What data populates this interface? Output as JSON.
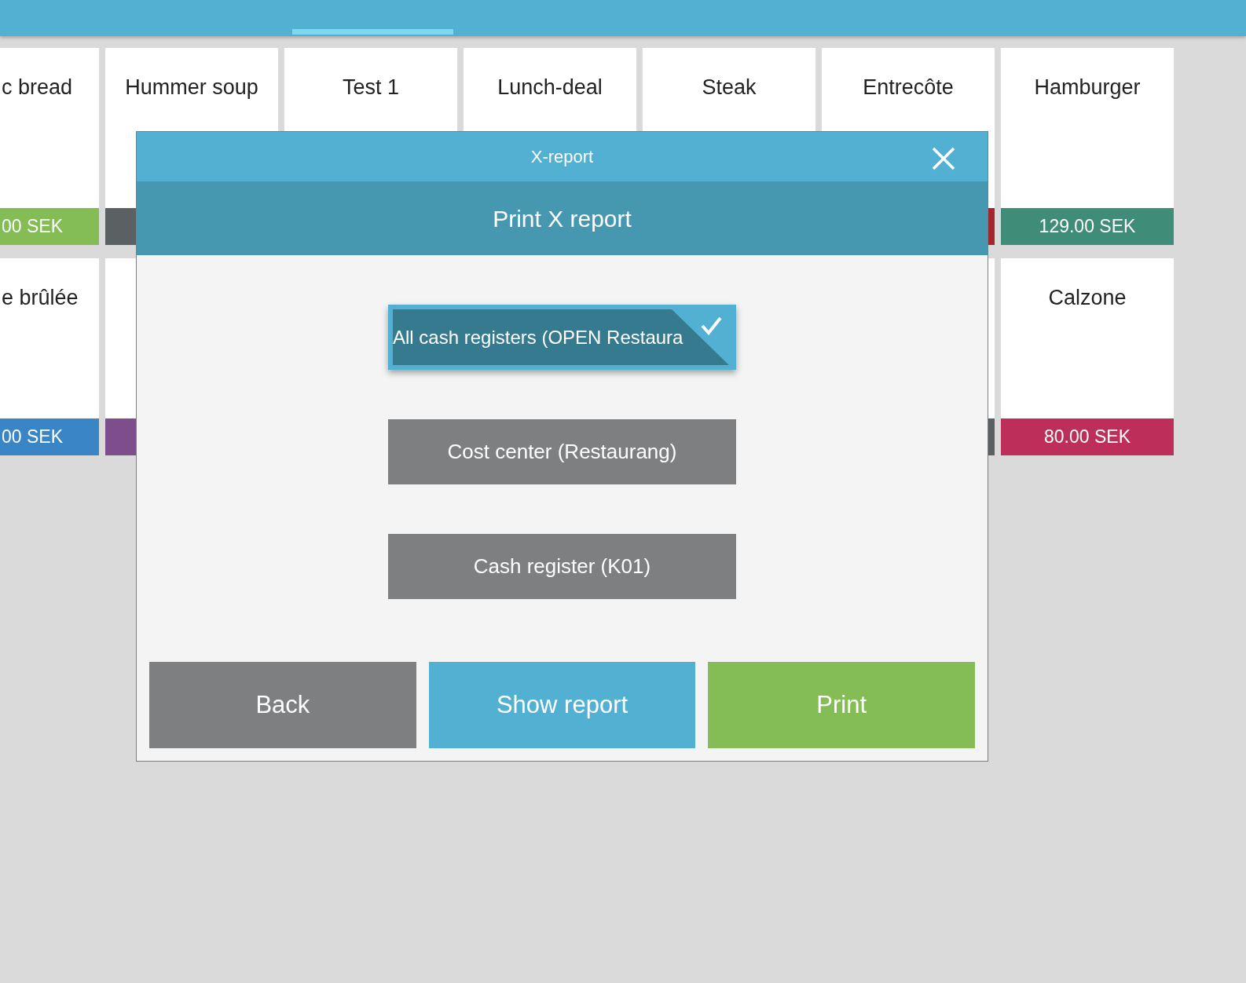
{
  "product_grid": {
    "rows": [
      [
        {
          "name": "c bread",
          "price": "00 SEK",
          "color": "#84bd55"
        },
        {
          "name": "Hummer soup",
          "color": "#5b6063"
        },
        {
          "name": "Test 1"
        },
        {
          "name": "Lunch-deal"
        },
        {
          "name": "Steak"
        },
        {
          "name": "Entrecôte",
          "color": "#a3272d"
        },
        {
          "name": "Hamburger",
          "price": "129.00 SEK",
          "color": "#3f8c78"
        }
      ],
      [
        {
          "name": "e brûlée",
          "price": "00 SEK",
          "color": "#3a85c6"
        },
        {
          "color": "#7e4e8c"
        },
        {},
        {},
        {},
        {
          "color": "#5b6063"
        },
        {
          "name": "Calzone",
          "price": "80.00 SEK",
          "color": "#bd2f5a"
        }
      ]
    ]
  },
  "dialog": {
    "title": "X-report",
    "heading": "Print X report",
    "options": [
      {
        "label": "All cash registers (OPEN Restaura",
        "selected": true
      },
      {
        "label": "Cost center (Restaurang)",
        "selected": false
      },
      {
        "label": "Cash register (K01)",
        "selected": false
      }
    ],
    "buttons": [
      {
        "label": "Back",
        "kind": "neutral"
      },
      {
        "label": "Show report",
        "kind": "info"
      },
      {
        "label": "Print",
        "kind": "confirm"
      }
    ]
  }
}
